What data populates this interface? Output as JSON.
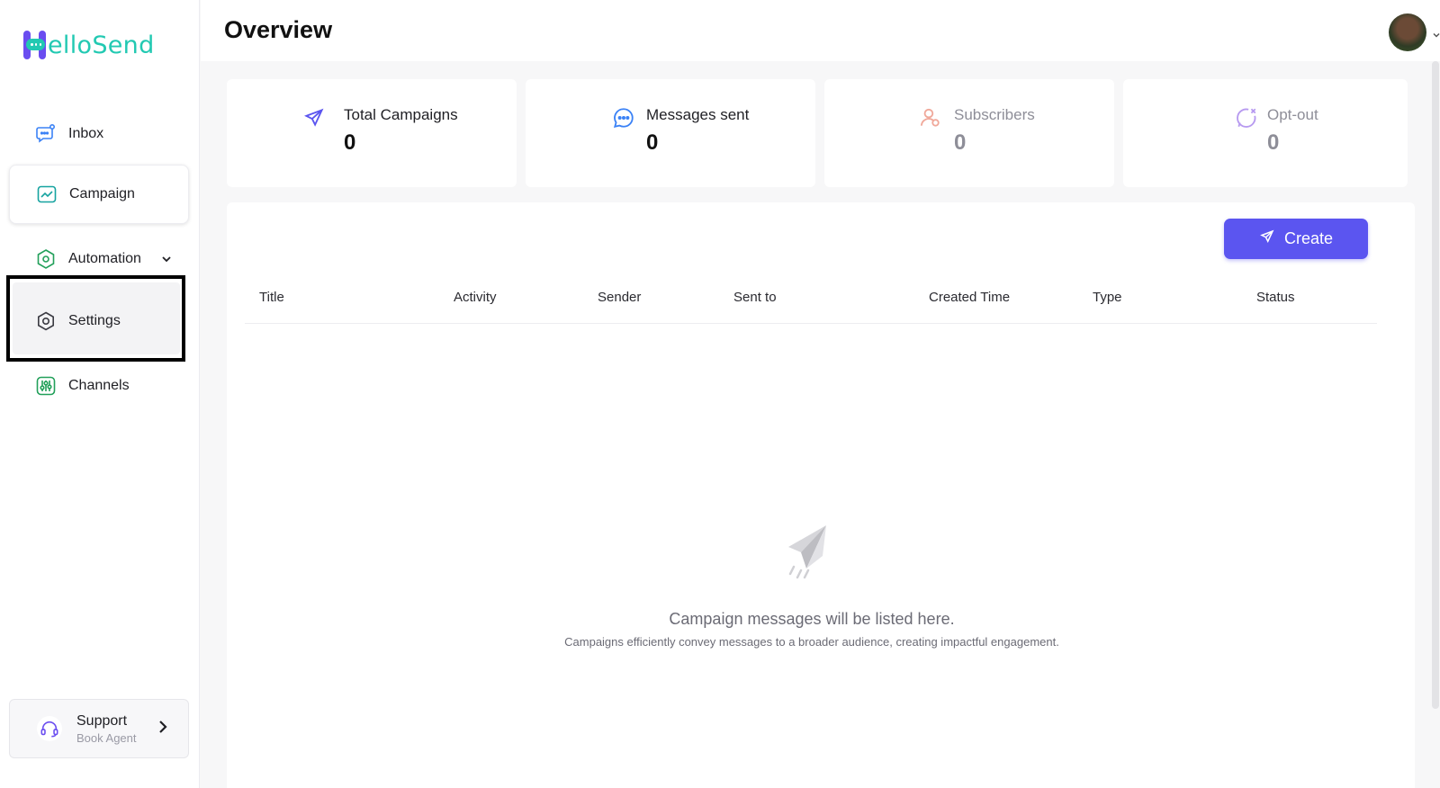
{
  "brand": {
    "name": "elloSend",
    "accent": "#5b55f0",
    "teal": "#22c9b2"
  },
  "sidebar": {
    "items": [
      {
        "label": "Inbox",
        "icon": "chat-bubble-icon"
      },
      {
        "label": "Campaign",
        "icon": "chart-line-icon",
        "active": true
      },
      {
        "label": "Automation",
        "icon": "hexagon-icon"
      },
      {
        "label": "Settings",
        "icon": "gear-icon"
      },
      {
        "label": "Channels",
        "icon": "sliders-icon"
      }
    ],
    "support": {
      "title": "Support",
      "subtitle": "Book Agent"
    }
  },
  "header": {
    "title": "Overview"
  },
  "stats": [
    {
      "label": "Total Campaigns",
      "value": "0",
      "icon": "paper-plane-icon"
    },
    {
      "label": "Messages sent",
      "value": "0",
      "icon": "message-dots-icon"
    },
    {
      "label": "Subscribers",
      "value": "0",
      "icon": "user-icon"
    },
    {
      "label": "Opt-out",
      "value": "0",
      "icon": "chat-x-icon"
    }
  ],
  "campaigns": {
    "create_label": "Create",
    "columns": [
      "Title",
      "Activity",
      "Sender",
      "Sent to",
      "Created Time",
      "Type",
      "Status"
    ],
    "empty_title": "Campaign messages will be listed here.",
    "empty_subtitle": "Campaigns efficiently convey messages to a broader audience, creating impactful engagement."
  }
}
